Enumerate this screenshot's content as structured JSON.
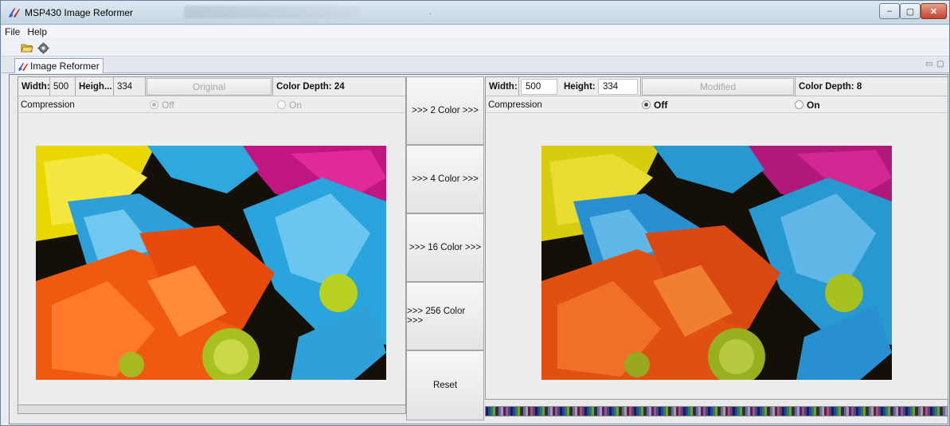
{
  "window": {
    "title": "MSP430 Image Reformer",
    "controls": {
      "minimize": "–",
      "maximize": "▢",
      "close": "✕"
    }
  },
  "menu": {
    "items": [
      "File",
      "Help"
    ]
  },
  "toolbar": {
    "icons": [
      "open-folder-icon",
      "gear-icon"
    ]
  },
  "tab": {
    "label": "Image Reformer"
  },
  "original": {
    "width_label": "Width:",
    "width_value": "500",
    "height_label": "Heigh...",
    "height_value": "334",
    "title_button": "Original",
    "color_depth": "Color Depth: 24",
    "compression_label": "Compression",
    "off_label": "Off",
    "on_label": "On",
    "selected": "Off",
    "enabled": false
  },
  "modified": {
    "width_label": "Width:",
    "width_value": "500",
    "height_label": "Height:",
    "height_value": "334",
    "title_button": "Modified",
    "color_depth": "Color Depth: 8",
    "compression_label": "Compression",
    "off_label": "Off",
    "on_label": "On",
    "selected": "Off",
    "enabled": true
  },
  "actions": {
    "color2": ">>> 2 Color >>>",
    "color4": ">>> 4 Color >>>",
    "color16": ">>> 16 Color >>>",
    "color256": ">>> 256 Color >>>",
    "reset": "Reset"
  },
  "colors": {
    "yellow": "#e8d800",
    "cyan": "#2fa8e0",
    "orange": "#f05a10",
    "magenta": "#c0167f",
    "green": "#a8c020"
  }
}
